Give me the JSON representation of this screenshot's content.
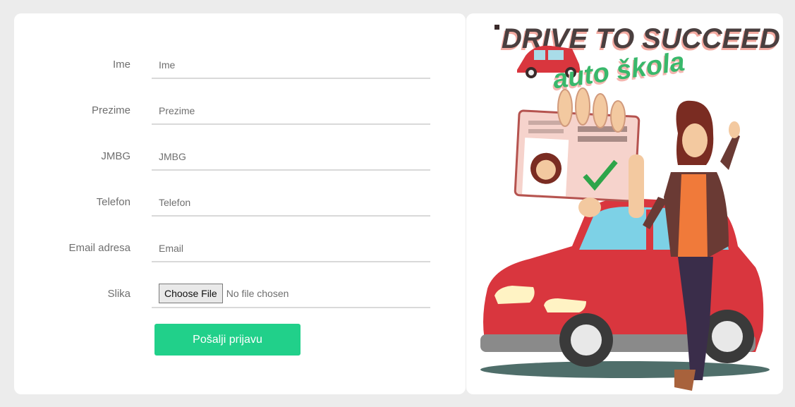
{
  "form": {
    "fields": [
      {
        "label": "Ime",
        "placeholder": "Ime"
      },
      {
        "label": "Prezime",
        "placeholder": "Prezime"
      },
      {
        "label": "JMBG",
        "placeholder": "JMBG"
      },
      {
        "label": "Telefon",
        "placeholder": "Telefon"
      },
      {
        "label": "Email adresa",
        "placeholder": "Email"
      }
    ],
    "file": {
      "label": "Slika",
      "button_label": "Choose File",
      "status": "No file chosen"
    },
    "submit_label": "Pošalji prijavu"
  },
  "banner": {
    "headline": "DRIVE TO SUCCEED",
    "subtitle": "auto škola"
  },
  "colors": {
    "accent": "#21d08a",
    "car_red": "#d9363e",
    "headline": "#4a3f3f",
    "subtitle_green": "#39b86b"
  }
}
